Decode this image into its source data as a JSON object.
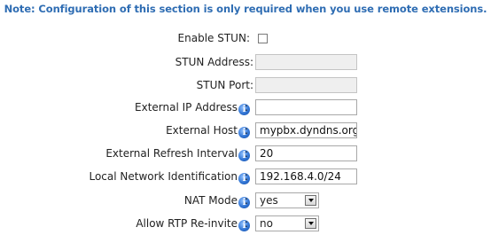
{
  "note": "Note: Configuration of this section is only required when you use remote extensions.",
  "fields": {
    "enable_stun": {
      "label": "Enable STUN",
      "checked": false
    },
    "stun_address": {
      "label": "STUN Address",
      "value": ""
    },
    "stun_port": {
      "label": "STUN Port",
      "value": ""
    },
    "external_ip": {
      "label": "External IP Address",
      "value": ""
    },
    "external_host": {
      "label": "External Host",
      "value": "mypbx.dyndns.org"
    },
    "external_refresh": {
      "label": "External Refresh Interval",
      "value": "20"
    },
    "local_network": {
      "label": "Local Network Identification",
      "value": "192.168.4.0/24"
    },
    "nat_mode": {
      "label": "NAT Mode",
      "value": "yes"
    },
    "rtp_reinvite": {
      "label": "Allow RTP Re-invite",
      "value": "no"
    }
  },
  "colon": ":",
  "help_glyph": "i",
  "icon_names": {
    "help": "info-icon",
    "dropdown": "chevron-down-icon"
  }
}
